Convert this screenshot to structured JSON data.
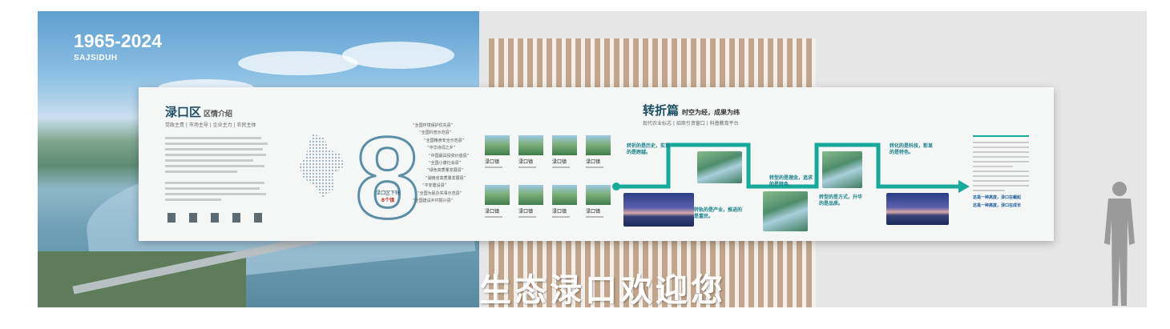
{
  "banner": {
    "years": "1965-2024",
    "code": "SAJSIDUH",
    "slogan": "生态渌口欢迎您"
  },
  "intro": {
    "title": "渌口区",
    "subtitle": "区情介绍",
    "tags": "党政主责 | 市场主导 | 企业主力 | 农民主体",
    "number": "8",
    "number_caption_1": "渌口区下辖",
    "number_caption_2": "8个镇",
    "towns": [
      "“全国环境保护优先县”",
      "“全国科普示范县”",
      "“全国粮食安全示范县”",
      "“中华诗词之乡”",
      "“中国最具投资价值县”",
      "“全国小康社会县”",
      "“绿色高质量发展县”",
      "“湖南省高质量发展县”",
      "“平安建设县”",
      "“全国为民办实事示范县”",
      "“全国建设乡村振兴县”"
    ],
    "town_cells": [
      "渌口镇",
      "渌口镇",
      "渌口镇",
      "渌口镇",
      "渌口镇",
      "渌口镇",
      "渌口镇",
      "渌口镇"
    ]
  },
  "turning": {
    "title": "转折篇",
    "subtitle": "时空为经，成果为纬",
    "tags": "现代农业标志 | 招商引资窗口 | 科普教育平台",
    "notes": [
      "转折的是历史，实现的是跨越。",
      "转型的是理念，追求的是特色。",
      "转化的是科技，彰显的是特色。",
      "转轨的是产业，推进的是富民。",
      "转型的是方式，升华的是品质。"
    ],
    "closing_1": "这是一种高度，渌口在崛起",
    "closing_2": "这是一种高度，渌口在成长"
  },
  "colors": {
    "teal": "#17808a",
    "navy": "#1a4d63",
    "stripe": "#c2a58a"
  }
}
